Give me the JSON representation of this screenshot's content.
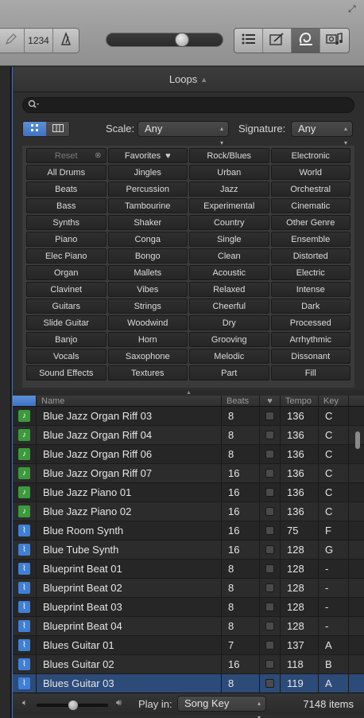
{
  "toolbar": {
    "count_label": "1234",
    "volume_level": 0.66,
    "views": [
      "list",
      "notepad",
      "loops",
      "media"
    ],
    "active_view": "loops"
  },
  "panel": {
    "title": "Loops"
  },
  "filters": {
    "search_placeholder": "",
    "scale_label": "Scale:",
    "scale_value": "Any",
    "signature_label": "Signature:",
    "signature_value": "Any"
  },
  "keywords": [
    [
      "Reset",
      "Favorites",
      "Rock/Blues",
      "Electronic"
    ],
    [
      "All Drums",
      "Jingles",
      "Urban",
      "World"
    ],
    [
      "Beats",
      "Percussion",
      "Jazz",
      "Orchestral"
    ],
    [
      "Bass",
      "Tambourine",
      "Experimental",
      "Cinematic"
    ],
    [
      "Synths",
      "Shaker",
      "Country",
      "Other Genre"
    ],
    [
      "Piano",
      "Conga",
      "Single",
      "Ensemble"
    ],
    [
      "Elec Piano",
      "Bongo",
      "Clean",
      "Distorted"
    ],
    [
      "Organ",
      "Mallets",
      "Acoustic",
      "Electric"
    ],
    [
      "Clavinet",
      "Vibes",
      "Relaxed",
      "Intense"
    ],
    [
      "Guitars",
      "Strings",
      "Cheerful",
      "Dark"
    ],
    [
      "Slide Guitar",
      "Woodwind",
      "Dry",
      "Processed"
    ],
    [
      "Banjo",
      "Horn",
      "Grooving",
      "Arrhythmic"
    ],
    [
      "Vocals",
      "Saxophone",
      "Melodic",
      "Dissonant"
    ],
    [
      "Sound Effects",
      "Textures",
      "Part",
      "Fill"
    ]
  ],
  "table": {
    "headers": {
      "name": "Name",
      "beats": "Beats",
      "tempo": "Tempo",
      "key": "Key"
    },
    "rows": [
      {
        "type": "midi",
        "name": "Blue Jazz Organ Riff 03",
        "beats": "8",
        "tempo": "136",
        "key": "C"
      },
      {
        "type": "midi",
        "name": "Blue Jazz Organ Riff 04",
        "beats": "8",
        "tempo": "136",
        "key": "C"
      },
      {
        "type": "midi",
        "name": "Blue Jazz Organ Riff 06",
        "beats": "8",
        "tempo": "136",
        "key": "C"
      },
      {
        "type": "midi",
        "name": "Blue Jazz Organ Riff 07",
        "beats": "16",
        "tempo": "136",
        "key": "C"
      },
      {
        "type": "midi",
        "name": "Blue Jazz Piano 01",
        "beats": "16",
        "tempo": "136",
        "key": "C"
      },
      {
        "type": "midi",
        "name": "Blue Jazz Piano 02",
        "beats": "16",
        "tempo": "136",
        "key": "C"
      },
      {
        "type": "audio",
        "name": "Blue Room Synth",
        "beats": "16",
        "tempo": "75",
        "key": "F"
      },
      {
        "type": "audio",
        "name": "Blue Tube Synth",
        "beats": "16",
        "tempo": "128",
        "key": "G"
      },
      {
        "type": "audio",
        "name": "Blueprint Beat 01",
        "beats": "8",
        "tempo": "128",
        "key": "-"
      },
      {
        "type": "audio",
        "name": "Blueprint Beat 02",
        "beats": "8",
        "tempo": "128",
        "key": "-"
      },
      {
        "type": "audio",
        "name": "Blueprint Beat 03",
        "beats": "8",
        "tempo": "128",
        "key": "-"
      },
      {
        "type": "audio",
        "name": "Blueprint Beat 04",
        "beats": "8",
        "tempo": "128",
        "key": "-"
      },
      {
        "type": "audio",
        "name": "Blues Guitar 01",
        "beats": "7",
        "tempo": "137",
        "key": "A"
      },
      {
        "type": "audio",
        "name": "Blues Guitar 02",
        "beats": "16",
        "tempo": "118",
        "key": "B"
      },
      {
        "type": "audio",
        "name": "Blues Guitar 03",
        "beats": "8",
        "tempo": "119",
        "key": "A",
        "selected": true
      }
    ]
  },
  "footer": {
    "preview_volume": 0.5,
    "play_in_label": "Play in:",
    "play_in_value": "Song Key",
    "items_count": "7148 items"
  },
  "colors": {
    "accent_blue": "#3f73c2",
    "midi_green": "#3b9a3b",
    "audio_blue": "#3f7fd6",
    "selection": "#2c4b78"
  }
}
